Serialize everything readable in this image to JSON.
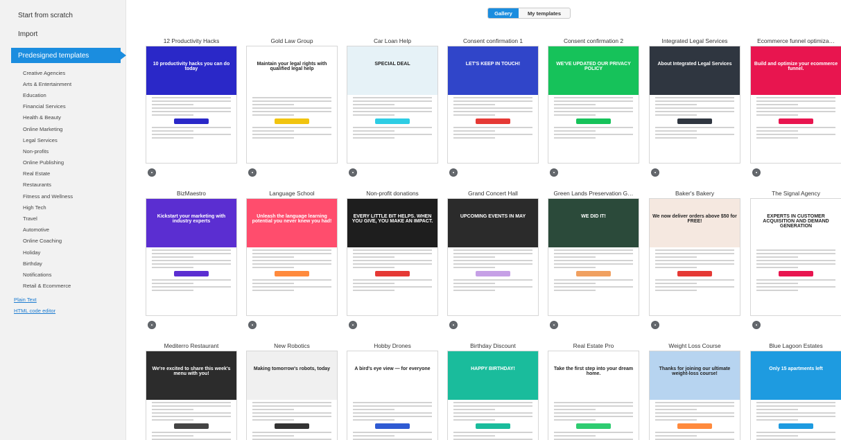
{
  "sidebar": {
    "start_from_scratch": "Start from scratch",
    "import": "Import",
    "predesigned": "Predesigned templates",
    "categories": [
      "Creative Agencies",
      "Arts & Entertainment",
      "Education",
      "Financial Services",
      "Health & Beauty",
      "Online Marketing",
      "Legal Services",
      "Non-profits",
      "Online Publishing",
      "Real Estate",
      "Restaurants",
      "Fitness and Wellness",
      "High Tech",
      "Travel",
      "Automotive",
      "Online Coaching",
      "Holiday",
      "Birthday",
      "Notifications",
      "Retail & Ecommerce"
    ],
    "links": [
      "Plain Text",
      "HTML code editor"
    ]
  },
  "toggle": {
    "gallery": "Gallery",
    "my_templates": "My templates"
  },
  "templates": [
    {
      "name": "12 Productivity Hacks",
      "headline": "10 productivity hacks you can do today",
      "bg": "#2a28c8",
      "accent": "#2a28c8"
    },
    {
      "name": "Gold Law Group",
      "headline": "Maintain your legal rights with qualified legal help",
      "bg": "#ffffff",
      "accent": "#f1c40f"
    },
    {
      "name": "Car Loan Help",
      "headline": "SPECIAL DEAL",
      "bg": "#e6f2f7",
      "accent": "#2ecde4"
    },
    {
      "name": "Consent confirmation 1",
      "headline": "LET'S KEEP IN TOUCH!",
      "bg": "#3045c9",
      "accent": "#e53935"
    },
    {
      "name": "Consent confirmation 2",
      "headline": "WE'VE UPDATED OUR PRIVACY POLICY",
      "bg": "#16c25a",
      "accent": "#16c25a"
    },
    {
      "name": "Integrated Legal Services",
      "headline": "About Integrated Legal Services",
      "bg": "#2f3640",
      "accent": "#2f3640"
    },
    {
      "name": "Ecommerce funnel optimiza…",
      "headline": "Build and optimize your ecommerce funnel.",
      "bg": "#e8154f",
      "accent": "#e8154f"
    },
    {
      "name": "BizMaestro",
      "headline": "Kickstart your marketing with industry experts",
      "bg": "#5b2ed1",
      "accent": "#5b2ed1"
    },
    {
      "name": "Language School",
      "headline": "Unleash the language learning potential you never knew you had!",
      "bg": "#ff4d6d",
      "accent": "#ff8a3d"
    },
    {
      "name": "Non-profit donations",
      "headline": "EVERY LITTLE BIT HELPS. WHEN YOU GIVE, YOU MAKE AN IMPACT.",
      "bg": "#1e1e1e",
      "accent": "#e53935"
    },
    {
      "name": "Grand Concert Hall",
      "headline": "UPCOMING EVENTS IN MAY",
      "bg": "#2b2b2b",
      "accent": "#c6a0e6"
    },
    {
      "name": "Green Lands Preservation G…",
      "headline": "WE DID IT!",
      "bg": "#2b4a3a",
      "accent": "#f0a060"
    },
    {
      "name": "Baker's Bakery",
      "headline": "We now deliver orders above $50 for FREE!",
      "bg": "#f5e8e0",
      "accent": "#e53935"
    },
    {
      "name": "The Signal Agency",
      "headline": "EXPERTS IN CUSTOMER ACQUISITION AND DEMAND GENERATION",
      "bg": "#ffffff",
      "accent": "#e8154f"
    },
    {
      "name": "Mediterro Restaurant",
      "headline": "We're excited to share this week's menu with you!",
      "bg": "#2c2c2c",
      "accent": "#ffffff"
    },
    {
      "name": "New Robotics",
      "headline": "Making tomorrow's robots, today",
      "bg": "#f0f0f0",
      "accent": "#333333"
    },
    {
      "name": "Hobby Drones",
      "headline": "A bird's eye view — for everyone",
      "bg": "#ffffff",
      "accent": "#2f5bd3"
    },
    {
      "name": "Birthday Discount",
      "headline": "HAPPY BIRTHDAY!",
      "bg": "#1abc9c",
      "accent": "#1abc9c"
    },
    {
      "name": "Real Estate Pro",
      "headline": "Take the first step into your dream home.",
      "bg": "#ffffff",
      "accent": "#2ecc71"
    },
    {
      "name": "Weight Loss Course",
      "headline": "Thanks for joining our ultimate weight-loss course!",
      "bg": "#b7d4f0",
      "accent": "#ff8a3d"
    },
    {
      "name": "Blue Lagoon Estates",
      "headline": "Only 15 apartments left",
      "bg": "#1e9be0",
      "accent": "#1e9be0"
    }
  ]
}
